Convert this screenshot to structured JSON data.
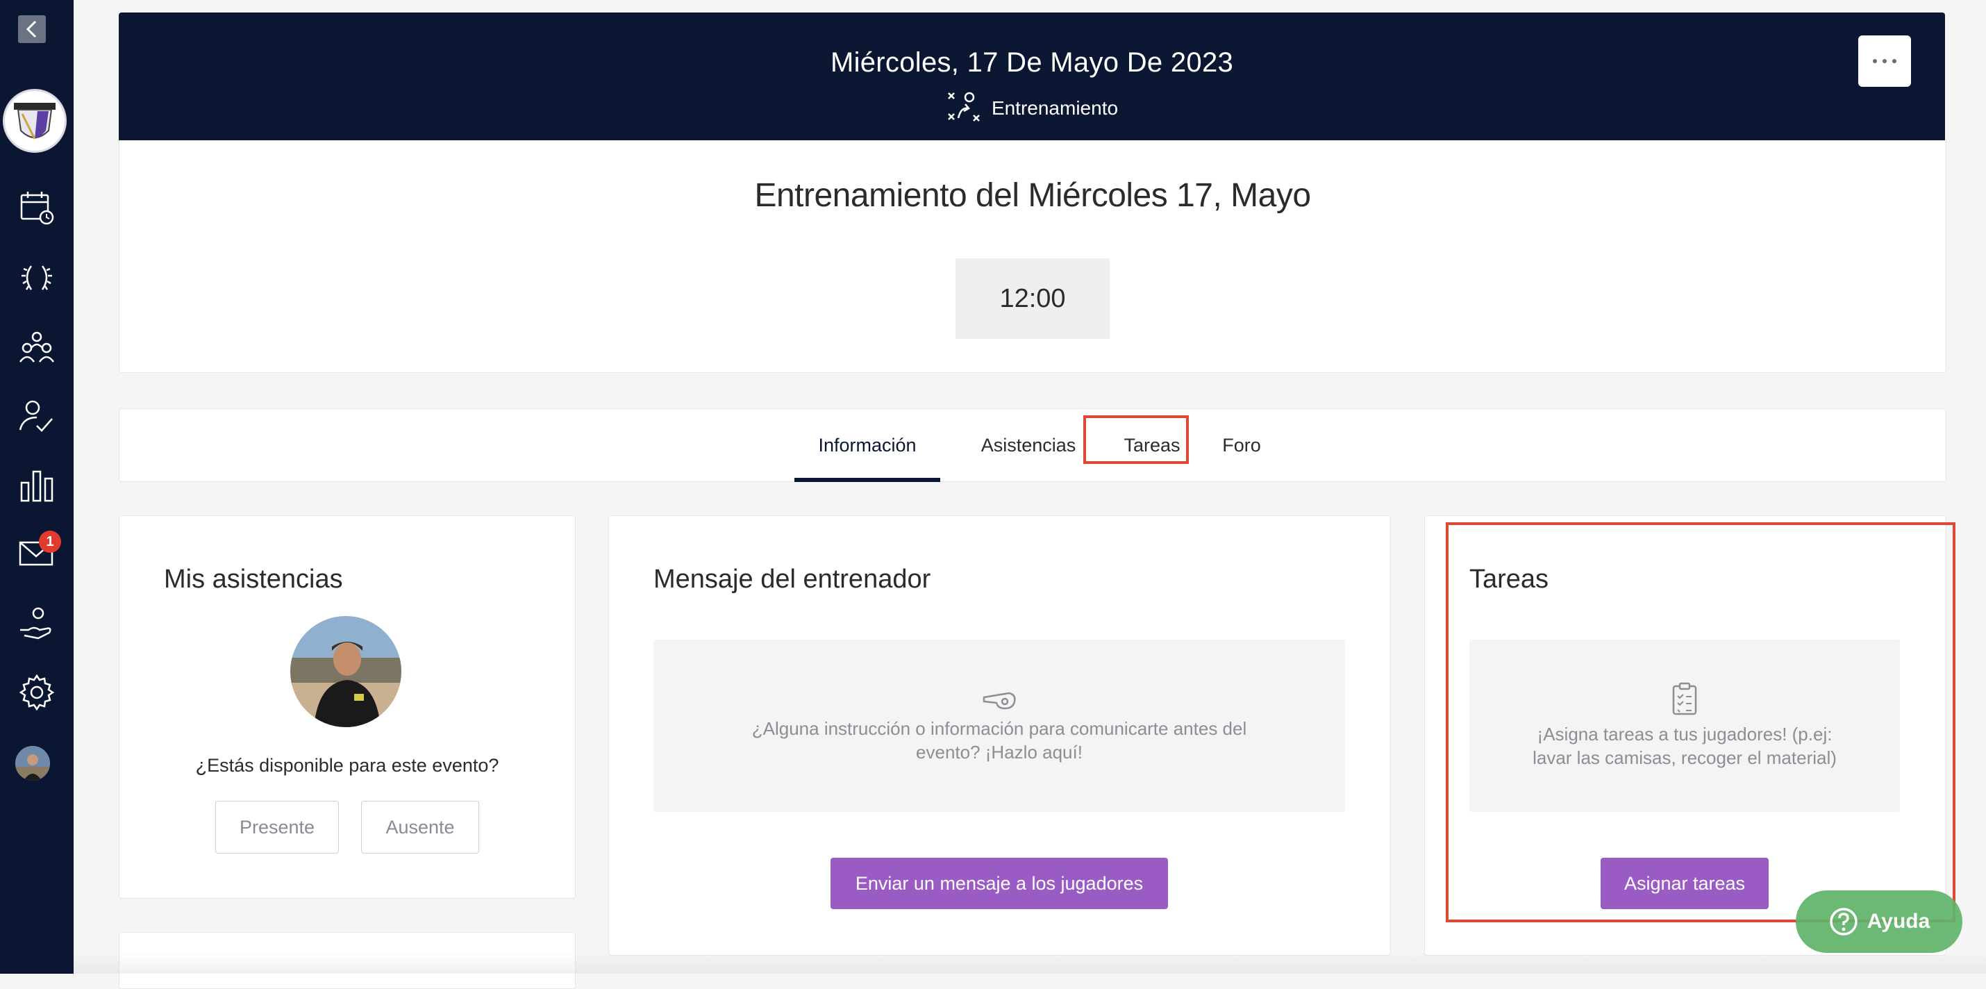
{
  "sidebar": {
    "items": [
      {
        "icon": "calendar-clock-icon"
      },
      {
        "icon": "laurel-wreath-icon"
      },
      {
        "icon": "team-icon"
      },
      {
        "icon": "user-check-icon"
      },
      {
        "icon": "bar-chart-icon"
      },
      {
        "icon": "mail-icon"
      },
      {
        "icon": "hand-support-icon"
      },
      {
        "icon": "gear-icon"
      }
    ],
    "mail_badge": "1"
  },
  "event": {
    "date": "Miércoles, 17 De Mayo De 2023",
    "type": "Entrenamiento",
    "title": "Entrenamiento del Miércoles 17, Mayo",
    "time": "12:00"
  },
  "tabs": [
    {
      "label": "Información",
      "active": true
    },
    {
      "label": "Asistencias",
      "active": false
    },
    {
      "label": "Tareas",
      "active": false
    },
    {
      "label": "Foro",
      "active": false
    }
  ],
  "attendance": {
    "title": "Mis asistencias",
    "question": "¿Estás disponible para este evento?",
    "present_label": "Presente",
    "absent_label": "Ausente"
  },
  "coach_message": {
    "title": "Mensaje del entrenador",
    "hint_line1": "¿Alguna instrucción o información para comunicarte antes del",
    "hint_line2": "evento? ¡Hazlo aquí!",
    "button_label": "Enviar un mensaje a los jugadores"
  },
  "tasks": {
    "title": "Tareas",
    "hint_line1": "¡Asigna tareas a tus jugadores! (p.ej:",
    "hint_line2": "lavar las camisas, recoger el material)",
    "button_label": "Asignar tareas"
  },
  "help": {
    "label": "Ayuda"
  },
  "colors": {
    "navy": "#0b1633",
    "purple": "#9a5cc4",
    "highlight": "#e04836",
    "help_green": "#5fb46a"
  }
}
